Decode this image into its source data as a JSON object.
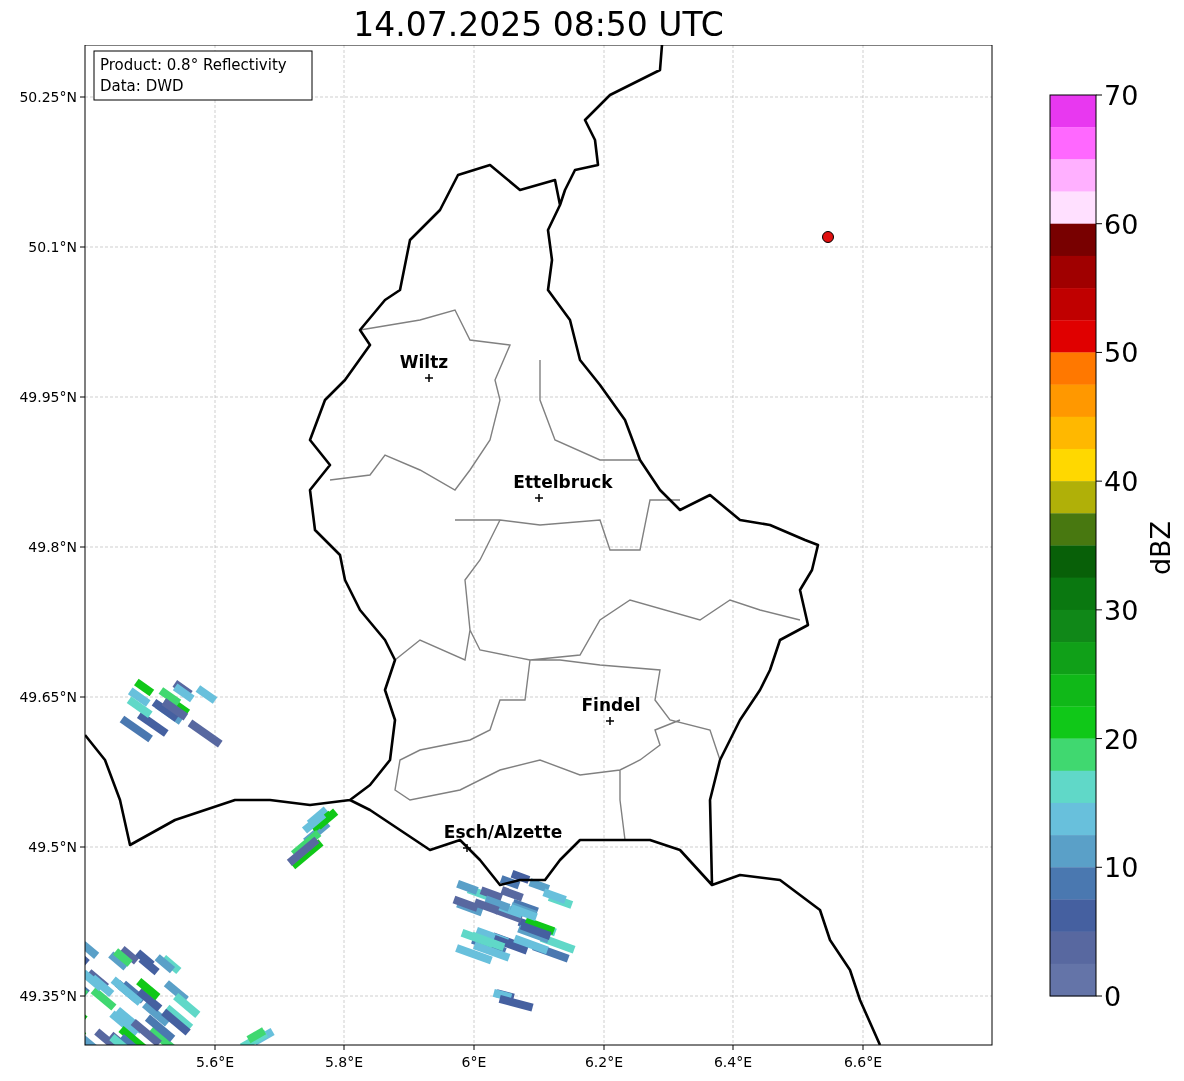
{
  "title": "14.07.2025 08:50 UTC",
  "info_box": {
    "lines": [
      "Product: 0.8° Reflectivity",
      "Data: DWD"
    ]
  },
  "map": {
    "lon_ticks": [
      "5.6°E",
      "5.8°E",
      "6°E",
      "6.2°E",
      "6.4°E",
      "6.6°E"
    ],
    "lat_ticks": [
      "50.25°N",
      "50.1°N",
      "49.95°N",
      "49.8°N",
      "49.65°N",
      "49.5°N",
      "49.35°N"
    ],
    "cities": [
      {
        "name": "Wiltz"
      },
      {
        "name": "Ettelbruck"
      },
      {
        "name": "Findel"
      },
      {
        "name": "Esch/Alzette"
      }
    ]
  },
  "colorbar": {
    "label": "dBZ",
    "ticks": [
      "70",
      "60",
      "50",
      "40",
      "30",
      "20",
      "10",
      "0"
    ],
    "bins": [
      {
        "color": "#e838f0"
      },
      {
        "color": "#ff68ff"
      },
      {
        "color": "#ffb0ff"
      },
      {
        "color": "#ffe0ff"
      },
      {
        "color": "#780000"
      },
      {
        "color": "#a00000"
      },
      {
        "color": "#c00000"
      },
      {
        "color": "#e00000"
      },
      {
        "color": "#ff7800"
      },
      {
        "color": "#ff9800"
      },
      {
        "color": "#ffb800"
      },
      {
        "color": "#ffd800"
      },
      {
        "color": "#b0b008"
      },
      {
        "color": "#487810"
      },
      {
        "color": "#086008"
      },
      {
        "color": "#0a7810"
      },
      {
        "color": "#108818"
      },
      {
        "color": "#10a018"
      },
      {
        "color": "#10b818"
      },
      {
        "color": "#10c818"
      },
      {
        "color": "#40d870"
      },
      {
        "color": "#60d8c8"
      },
      {
        "color": "#68c0dc"
      },
      {
        "color": "#5aa0c8"
      },
      {
        "color": "#4a78b0"
      },
      {
        "color": "#4560a0"
      },
      {
        "color": "#5868a0"
      },
      {
        "color": "#6474a8"
      }
    ]
  }
}
